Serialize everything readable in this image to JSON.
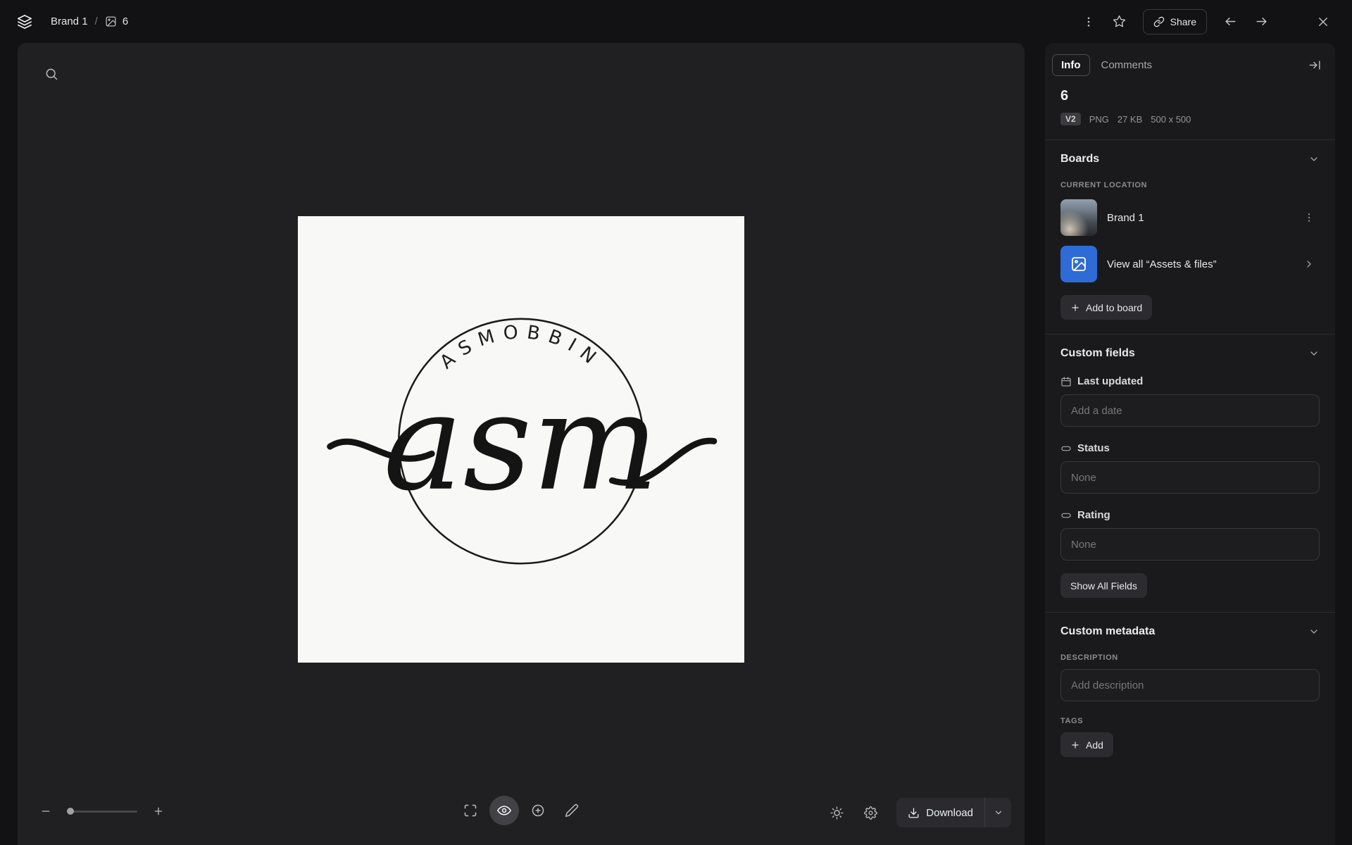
{
  "topbar": {
    "breadcrumb": {
      "board": "Brand 1",
      "separator": "/",
      "asset": "6"
    },
    "share_label": "Share"
  },
  "canvas": {
    "logo": {
      "arc_text": "ASMOBBIN",
      "script_text": "asm"
    },
    "download_label": "Download"
  },
  "sidebar": {
    "tabs": [
      {
        "label": "Info",
        "active": true
      },
      {
        "label": "Comments",
        "active": false
      }
    ],
    "title": "6",
    "meta": {
      "version": "V2",
      "format": "PNG",
      "size": "27 KB",
      "dimensions": "500 x 500"
    },
    "boards": {
      "header": "Boards",
      "current_location_label": "CURRENT LOCATION",
      "board_name": "Brand 1",
      "view_all_label": "View all “Assets & files”",
      "add_to_board_label": "Add to board"
    },
    "custom_fields": {
      "header": "Custom fields",
      "fields": [
        {
          "label": "Last updated",
          "placeholder": "Add a date"
        },
        {
          "label": "Status",
          "placeholder": "None"
        },
        {
          "label": "Rating",
          "placeholder": "None"
        }
      ],
      "show_all_label": "Show All Fields"
    },
    "custom_metadata": {
      "header": "Custom metadata",
      "description_label": "DESCRIPTION",
      "description_placeholder": "Add description",
      "tags_label": "TAGS",
      "add_label": "Add"
    }
  },
  "colors": {
    "canvas_bg": "#202023",
    "sidebar_bg": "#1a1a1d",
    "page_bg": "#121214",
    "view_all_tile": "#2e6bd6",
    "artboard_bg": "#f8f8f6"
  }
}
